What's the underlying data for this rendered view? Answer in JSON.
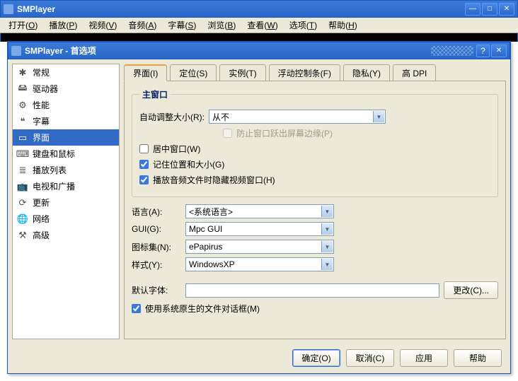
{
  "main": {
    "title": "SMPlayer",
    "menu": [
      {
        "label": "打开",
        "key": "O"
      },
      {
        "label": "播放",
        "key": "P"
      },
      {
        "label": "视频",
        "key": "V"
      },
      {
        "label": "音频",
        "key": "A"
      },
      {
        "label": "字幕",
        "key": "S"
      },
      {
        "label": "浏览",
        "key": "B"
      },
      {
        "label": "查看",
        "key": "W"
      },
      {
        "label": "选项",
        "key": "T"
      },
      {
        "label": "帮助",
        "key": "H"
      }
    ]
  },
  "dialog": {
    "title": "SMPlayer - 首选项",
    "sidebar": [
      {
        "icon": "✱",
        "label": "常规"
      },
      {
        "icon": "🖴",
        "label": "驱动器"
      },
      {
        "icon": "⚙",
        "label": "性能"
      },
      {
        "icon": "❝",
        "label": "字幕"
      },
      {
        "icon": "▭",
        "label": "界面",
        "selected": true
      },
      {
        "icon": "⌨",
        "label": "键盘和鼠标"
      },
      {
        "icon": "≣",
        "label": "播放列表"
      },
      {
        "icon": "📺",
        "label": "电视和广播"
      },
      {
        "icon": "⟳",
        "label": "更新"
      },
      {
        "icon": "🌐",
        "label": "网络"
      },
      {
        "icon": "⚒",
        "label": "高级"
      }
    ],
    "tabs": [
      {
        "label": "界面(I)",
        "active": true
      },
      {
        "label": "定位(S)"
      },
      {
        "label": "实例(T)"
      },
      {
        "label": "浮动控制条(F)"
      },
      {
        "label": "隐私(Y)"
      },
      {
        "label": "高 DPI"
      }
    ],
    "mainWindow": {
      "legend": "主窗口",
      "autoresize_label": "自动调整大小(R):",
      "autoresize_value": "从不",
      "prevent_offscreen": "防止窗口跃出屏幕边缘(P)",
      "center": "居中窗口(W)",
      "center_checked": false,
      "remember": "记住位置和大小(G)",
      "remember_checked": true,
      "hide_audio": "播放音频文件时隐藏视频窗口(H)",
      "hide_audio_checked": true
    },
    "language_label": "语言(A):",
    "language_value": "<系统语言>",
    "gui_label": "GUI(G):",
    "gui_value": "Mpc GUI",
    "iconset_label": "图标集(N):",
    "iconset_value": "ePapirus",
    "style_label": "样式(Y):",
    "style_value": "WindowsXP",
    "font_label": "默认字体:",
    "font_value": "",
    "change_btn": "更改(C)...",
    "native_dialog": "使用系统原生的文件对话框(M)",
    "native_dialog_checked": true,
    "footer": {
      "ok": "确定(O)",
      "cancel": "取消(C)",
      "apply": "应用",
      "help": "帮助"
    }
  }
}
